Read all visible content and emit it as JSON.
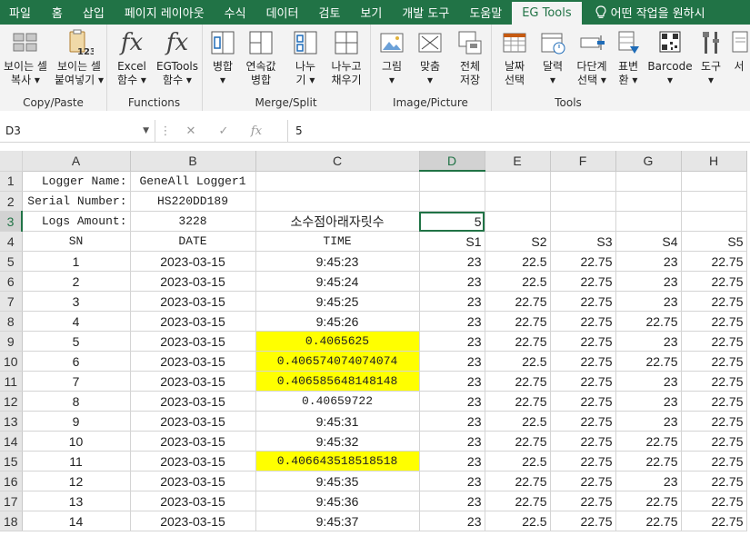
{
  "menubar": {
    "tabs": [
      "파일",
      "홈",
      "삽입",
      "페이지 레이아웃",
      "수식",
      "데이터",
      "검토",
      "보기",
      "개발 도구",
      "도움말",
      "EG Tools"
    ],
    "active_tab": "EG Tools",
    "tell_me": "어떤 작업을 원하시"
  },
  "ribbon": {
    "groups": {
      "copy_paste": {
        "name": "Copy/Paste",
        "buttons": [
          {
            "line1": "보이는 셀",
            "line2": "복사 ▾"
          },
          {
            "line1": "보이는 셀",
            "line2": "붙여넣기 ▾"
          }
        ]
      },
      "functions": {
        "name": "Functions",
        "buttons": [
          {
            "line1": "Excel",
            "line2": "함수 ▾"
          },
          {
            "line1": "EGTools",
            "line2": "함수 ▾"
          }
        ]
      },
      "merge_split": {
        "name": "Merge/Split",
        "buttons": [
          {
            "line1": "병합",
            "line2": "▾"
          },
          {
            "line1": "연속값",
            "line2": "병합"
          },
          {
            "line1": "나누",
            "line2": "기 ▾"
          },
          {
            "line1": "나누고",
            "line2": "채우기"
          }
        ]
      },
      "image_picture": {
        "name": "Image/Picture",
        "buttons": [
          {
            "line1": "그림",
            "line2": "▾"
          },
          {
            "line1": "맞춤",
            "line2": "▾"
          },
          {
            "line1": "전체",
            "line2": "저장"
          }
        ]
      },
      "tools": {
        "name": "Tools",
        "buttons": [
          {
            "line1": "날짜",
            "line2": "선택"
          },
          {
            "line1": "달력",
            "line2": "▾"
          },
          {
            "line1": "다단계",
            "line2": "선택 ▾"
          },
          {
            "line1": "표변",
            "line2": "환 ▾"
          },
          {
            "line1": "Barcode",
            "line2": "▾"
          },
          {
            "line1": "도구",
            "line2": "▾"
          },
          {
            "line1": "서",
            "line2": ""
          }
        ]
      }
    }
  },
  "formula_bar": {
    "name_box": "D3",
    "formula": "5"
  },
  "sheet": {
    "columns": [
      "A",
      "B",
      "C",
      "D",
      "E",
      "F",
      "G",
      "H"
    ],
    "selected_column": "D",
    "selected_row": "3",
    "rows": [
      {
        "n": "1",
        "cells": [
          "Logger Name:",
          "GeneAll Logger1",
          "",
          "",
          "",
          "",
          "",
          ""
        ]
      },
      {
        "n": "2",
        "cells": [
          "Serial Number:",
          "HS220DD189",
          "",
          "",
          "",
          "",
          "",
          ""
        ]
      },
      {
        "n": "3",
        "cells": [
          "Logs Amount:",
          "3228",
          "소수점아래자릿수",
          "5",
          "",
          "",
          "",
          ""
        ]
      },
      {
        "n": "4",
        "cells": [
          "SN",
          "DATE",
          "TIME",
          "S1",
          "S2",
          "S3",
          "S4",
          "S5"
        ]
      },
      {
        "n": "5",
        "cells": [
          "1",
          "2023-03-15",
          "9:45:23",
          "23",
          "22.5",
          "22.75",
          "23",
          "22.75"
        ]
      },
      {
        "n": "6",
        "cells": [
          "2",
          "2023-03-15",
          "9:45:24",
          "23",
          "22.5",
          "22.75",
          "23",
          "22.75"
        ]
      },
      {
        "n": "7",
        "cells": [
          "3",
          "2023-03-15",
          "9:45:25",
          "23",
          "22.75",
          "22.75",
          "23",
          "22.75"
        ]
      },
      {
        "n": "8",
        "cells": [
          "4",
          "2023-03-15",
          "9:45:26",
          "23",
          "22.75",
          "22.75",
          "22.75",
          "22.75"
        ]
      },
      {
        "n": "9",
        "cells": [
          "5",
          "2023-03-15",
          "0.4065625",
          "23",
          "22.75",
          "22.75",
          "23",
          "22.75"
        ]
      },
      {
        "n": "10",
        "cells": [
          "6",
          "2023-03-15",
          "0.406574074074074",
          "23",
          "22.5",
          "22.75",
          "22.75",
          "22.75"
        ]
      },
      {
        "n": "11",
        "cells": [
          "7",
          "2023-03-15",
          "0.406585648148148",
          "23",
          "22.75",
          "22.75",
          "23",
          "22.75"
        ]
      },
      {
        "n": "12",
        "cells": [
          "8",
          "2023-03-15",
          "0.40659722",
          "23",
          "22.75",
          "22.75",
          "23",
          "22.75"
        ]
      },
      {
        "n": "13",
        "cells": [
          "9",
          "2023-03-15",
          "9:45:31",
          "23",
          "22.5",
          "22.75",
          "23",
          "22.75"
        ]
      },
      {
        "n": "14",
        "cells": [
          "10",
          "2023-03-15",
          "9:45:32",
          "23",
          "22.75",
          "22.75",
          "22.75",
          "22.75"
        ]
      },
      {
        "n": "15",
        "cells": [
          "11",
          "2023-03-15",
          "0.406643518518518",
          "23",
          "22.5",
          "22.75",
          "22.75",
          "22.75"
        ]
      },
      {
        "n": "16",
        "cells": [
          "12",
          "2023-03-15",
          "9:45:35",
          "23",
          "22.75",
          "22.75",
          "23",
          "22.75"
        ]
      },
      {
        "n": "17",
        "cells": [
          "13",
          "2023-03-15",
          "9:45:36",
          "23",
          "22.75",
          "22.75",
          "22.75",
          "22.75"
        ]
      },
      {
        "n": "18",
        "cells": [
          "14",
          "2023-03-15",
          "9:45:37",
          "23",
          "22.5",
          "22.75",
          "22.75",
          "22.75"
        ]
      }
    ],
    "highlighted_cells": [
      "C9",
      "C10",
      "C11",
      "C15"
    ],
    "highlight_color": "#ffff00"
  },
  "colors": {
    "accent": "#217346",
    "grid_line": "#d4d4d4",
    "header_bg": "#e6e6e6"
  }
}
